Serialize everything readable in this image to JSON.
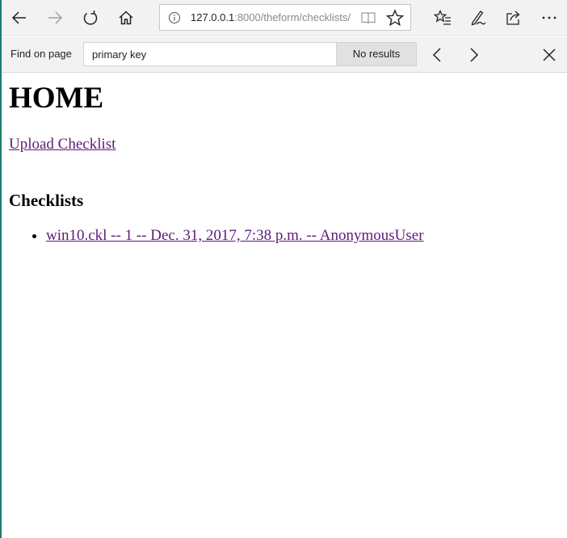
{
  "browser": {
    "address_host": "127.0.0.1",
    "address_path": ":8000/theform/checklists/",
    "icons": {
      "back": "back-arrow-icon",
      "forward": "forward-arrow-icon",
      "refresh": "refresh-icon",
      "home": "home-icon",
      "info": "info-icon",
      "reading_view": "reading-view-icon",
      "favorite": "star-icon",
      "favorites_hub": "favorites-list-icon",
      "notes": "pen-icon",
      "share": "share-icon",
      "more": "more-icon"
    }
  },
  "find_bar": {
    "label": "Find on page",
    "query": "primary key",
    "status": "No results"
  },
  "page": {
    "title": "HOME",
    "upload_link": "Upload Checklist",
    "section_title": "Checklists",
    "checklists": [
      "win10.ckl -- 1 -- Dec. 31, 2017, 7:38 p.m. -- AnonymousUser"
    ]
  },
  "colors": {
    "link_visited": "#5e1a7a",
    "chrome_bg": "#f2f2f2",
    "left_accent": "#1f7a6e"
  }
}
